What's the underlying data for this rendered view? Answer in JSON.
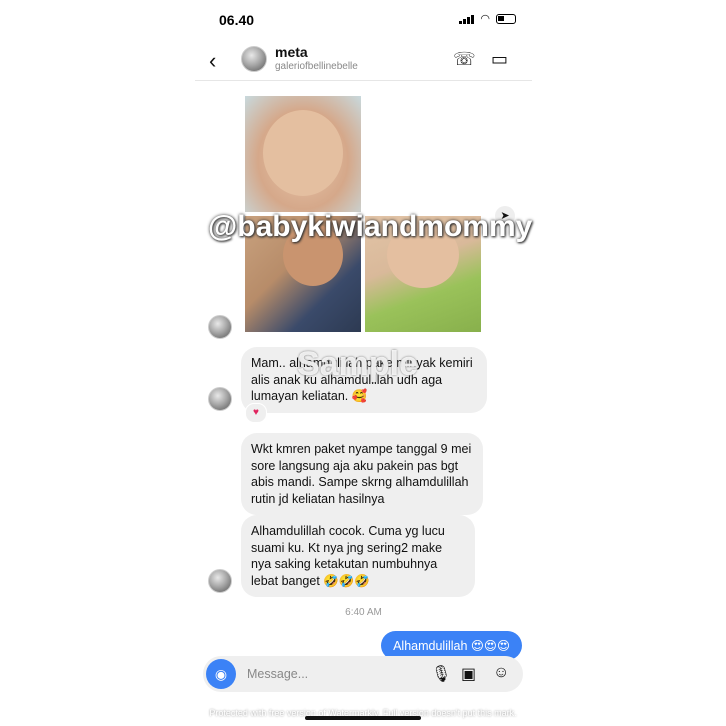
{
  "status": {
    "time": "06.40"
  },
  "header": {
    "name": "meta",
    "handle": "galeriofbellinebelle"
  },
  "watermark": "@babykiwiandmommy",
  "overlay_sample": "Sample",
  "messages": [
    "Mam.. alhamdulillah pake minyak kemiri alis anak ku alhamdulillah udh aga lumayan keliatan. 🥰",
    "Wkt kmren paket nyampe tanggal 9 mei sore langsung aja aku pakein pas bgt abis mandi. Sampe skrng alhamdulillah rutin jd keliatan hasilnya",
    "Alhamdulillah cocok. Cuma yg lucu suami ku. Kt nya jng sering2 make nya saking ketakutan numbuhnya lebat banget 🤣🤣🤣"
  ],
  "reaction": "♥",
  "timestamp": "6:40 AM",
  "sent_message": "Alhamdulillah 😍😍😍",
  "composer": {
    "placeholder": "Message..."
  },
  "footer_note": "Protected with free version of Watermarkly. Full version doesn't put this mark.",
  "icons": {
    "back": "‹",
    "call": "☏",
    "video": "▭",
    "camera": "◉",
    "mic": "🎙",
    "gallery": "▣",
    "sticker": "☺",
    "share": "➤"
  }
}
